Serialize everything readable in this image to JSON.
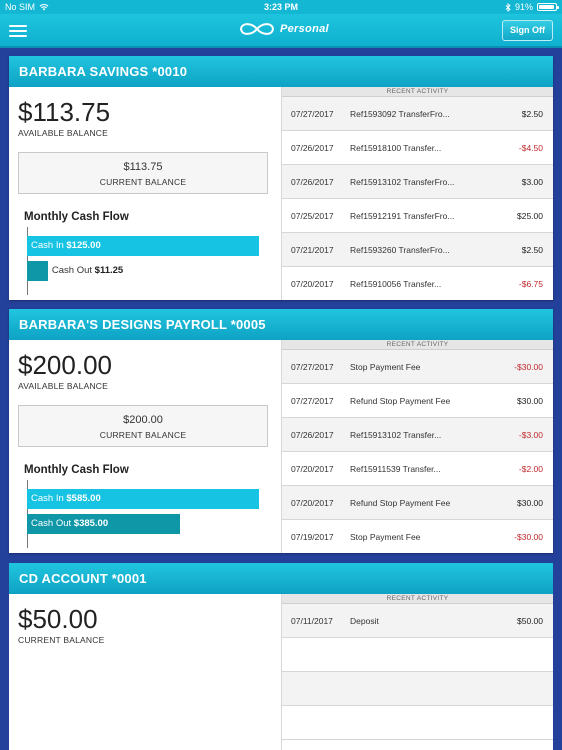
{
  "status_bar": {
    "carrier": "No SIM",
    "time": "3:23 PM",
    "battery": "91%",
    "battery_level": 0.91
  },
  "nav": {
    "logo_text": "Personal",
    "sign_off": "Sign Off"
  },
  "recent_activity_label": "RECENT ACTIVITY",
  "accounts": [
    {
      "name": "BARBARA SAVINGS *0010",
      "available_balance": "$113.75",
      "available_label": "AVAILABLE BALANCE",
      "current_balance": "$113.75",
      "current_label": "CURRENT BALANCE",
      "cash_flow": {
        "title": "Monthly Cash Flow",
        "in_label": "Cash In",
        "in_amount": "$125.00",
        "in_value": 125.0,
        "out_label": "Cash Out",
        "out_amount": "$11.25",
        "out_value": 11.25
      },
      "activity": [
        {
          "date": "07/27/2017",
          "desc": "Ref1593092 TransferFro...",
          "amount": "$2.50",
          "negative": false
        },
        {
          "date": "07/26/2017",
          "desc": "Ref15918100 Transfer...",
          "amount": "-$4.50",
          "negative": true
        },
        {
          "date": "07/26/2017",
          "desc": "Ref15913102 TransferFro...",
          "amount": "$3.00",
          "negative": false
        },
        {
          "date": "07/25/2017",
          "desc": "Ref15912191 TransferFro...",
          "amount": "$25.00",
          "negative": false
        },
        {
          "date": "07/21/2017",
          "desc": "Ref1593260 TransferFro...",
          "amount": "$2.50",
          "negative": false
        },
        {
          "date": "07/20/2017",
          "desc": "Ref15910056 Transfer...",
          "amount": "-$6.75",
          "negative": true
        }
      ]
    },
    {
      "name": "BARBARA'S DESIGNS PAYROLL *0005",
      "available_balance": "$200.00",
      "available_label": "AVAILABLE BALANCE",
      "current_balance": "$200.00",
      "current_label": "CURRENT BALANCE",
      "cash_flow": {
        "title": "Monthly Cash Flow",
        "in_label": "Cash In",
        "in_amount": "$585.00",
        "in_value": 585.0,
        "out_label": "Cash Out",
        "out_amount": "$385.00",
        "out_value": 385.0
      },
      "activity": [
        {
          "date": "07/27/2017",
          "desc": "Stop Payment Fee",
          "amount": "-$30.00",
          "negative": true
        },
        {
          "date": "07/27/2017",
          "desc": "Refund Stop Payment Fee",
          "amount": "$30.00",
          "negative": false
        },
        {
          "date": "07/26/2017",
          "desc": "Ref15913102 Transfer...",
          "amount": "-$3.00",
          "negative": true
        },
        {
          "date": "07/20/2017",
          "desc": "Ref15911539 Transfer...",
          "amount": "-$2.00",
          "negative": true
        },
        {
          "date": "07/20/2017",
          "desc": "Refund Stop Payment Fee",
          "amount": "$30.00",
          "negative": false
        },
        {
          "date": "07/19/2017",
          "desc": "Stop Payment Fee",
          "amount": "-$30.00",
          "negative": true
        }
      ]
    },
    {
      "name": "CD ACCOUNT *0001",
      "current_balance": "$50.00",
      "current_label": "CURRENT BALANCE",
      "activity": [
        {
          "date": "07/11/2017",
          "desc": "Deposit",
          "amount": "$50.00",
          "negative": false
        }
      ]
    }
  ],
  "colors": {
    "header": "#13b6d3",
    "background": "#23409a",
    "cash_in": "#17c3e2",
    "cash_out": "#0f97a8",
    "negative": "#c0282d"
  }
}
